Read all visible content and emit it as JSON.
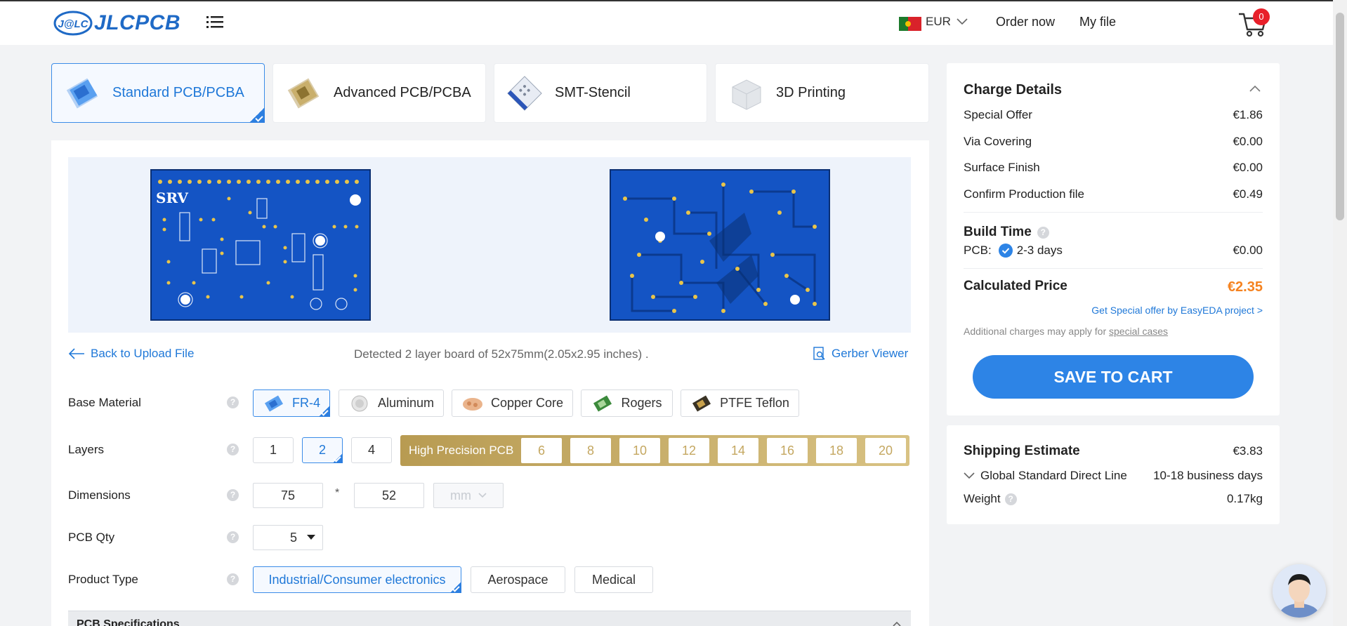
{
  "header": {
    "logo_text": "JLCPCB",
    "logo_mark": "J@LC",
    "currency": "EUR",
    "order_now": "Order now",
    "my_file": "My file",
    "cart_count": "0"
  },
  "tabs": [
    {
      "label": "Standard PCB/PCBA"
    },
    {
      "label": "Advanced PCB/PCBA"
    },
    {
      "label": "SMT-Stencil"
    },
    {
      "label": "3D Printing"
    }
  ],
  "upload": {
    "back_label": "Back to Upload File",
    "detected": "Detected 2 layer board of 52x75mm(2.05x2.95 inches) .",
    "gerber_viewer": "Gerber Viewer"
  },
  "form": {
    "base_material": {
      "label": "Base Material",
      "options": [
        "FR-4",
        "Aluminum",
        "Copper Core",
        "Rogers",
        "PTFE Teflon"
      ],
      "selected": "FR-4"
    },
    "layers": {
      "label": "Layers",
      "options": [
        "1",
        "2",
        "4"
      ],
      "selected": "2",
      "high_precision_label": "High Precision PCB",
      "high_precision_options": [
        "6",
        "8",
        "10",
        "12",
        "14",
        "16",
        "18",
        "20"
      ]
    },
    "dimensions": {
      "label": "Dimensions",
      "length": "75",
      "times": "*",
      "width": "52",
      "unit": "mm"
    },
    "pcb_qty": {
      "label": "PCB Qty",
      "value": "5"
    },
    "product_type": {
      "label": "Product Type",
      "options": [
        "Industrial/Consumer electronics",
        "Aerospace",
        "Medical"
      ],
      "selected": "Industrial/Consumer electronics"
    },
    "pcb_specifications": "PCB Specifications"
  },
  "charge": {
    "title": "Charge Details",
    "rows": [
      {
        "label": "Special Offer",
        "value": "€1.86"
      },
      {
        "label": "Via Covering",
        "value": "€0.00"
      },
      {
        "label": "Surface Finish",
        "value": "€0.00"
      },
      {
        "label": "Confirm Production file",
        "value": "€0.49"
      }
    ],
    "build_time_title": "Build Time",
    "pcb_label": "PCB:",
    "pcb_days": "2-3 days",
    "pcb_value": "€0.00",
    "calculated_label": "Calculated Price",
    "calculated_value": "€2.35",
    "special_offer_link": "Get Special offer by EasyEDA project >",
    "additional_prefix": "Additional charges may apply for",
    "additional_link": "special cases",
    "save_button": "SAVE TO CART"
  },
  "shipping": {
    "title": "Shipping Estimate",
    "price": "€3.83",
    "method": "Global Standard Direct Line",
    "days": "10-18 business days",
    "weight_label": "Weight",
    "weight_value": "0.17kg"
  },
  "colors": {
    "accent": "#2d84e6",
    "price": "#f5821f",
    "gold": "#c4a760"
  },
  "icons": [
    "menu-icon",
    "flag-portugal-icon",
    "chevron-down-icon",
    "cart-icon",
    "arrow-left-icon",
    "gerber-viewer-icon",
    "help-icon",
    "check-icon",
    "chevron-up-icon"
  ]
}
